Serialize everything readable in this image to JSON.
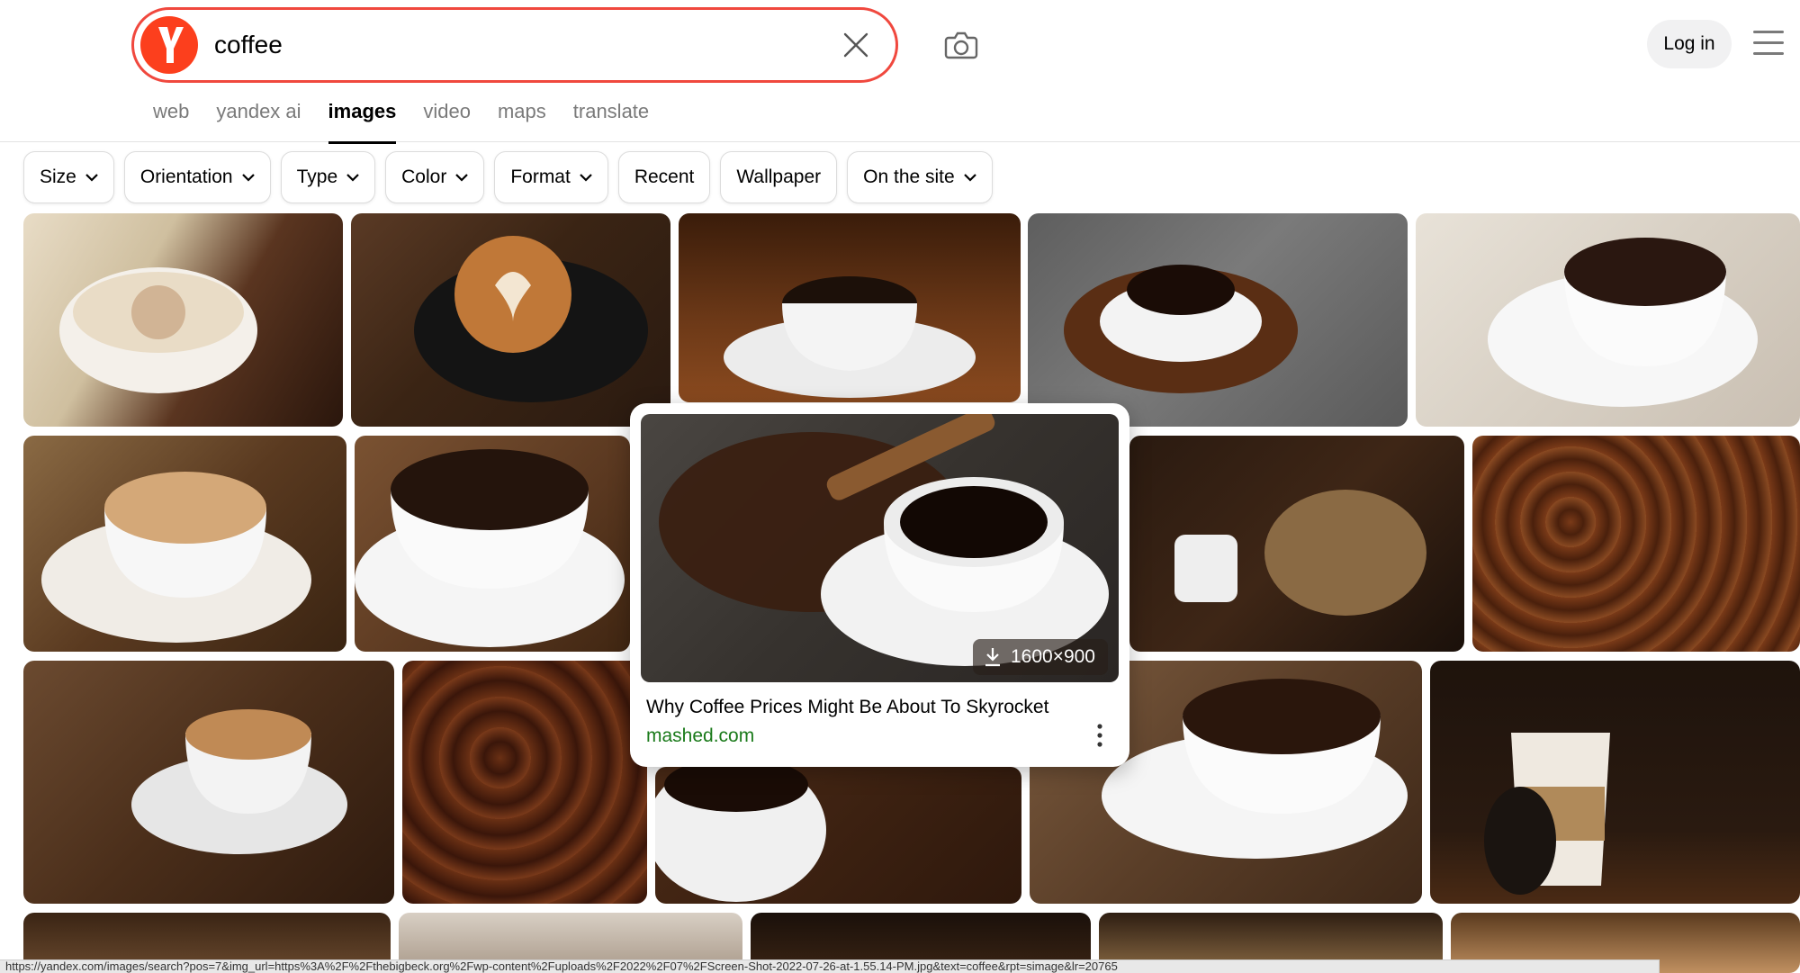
{
  "search": {
    "query": "coffee"
  },
  "header": {
    "login_label": "Log in"
  },
  "tabs": [
    {
      "label": "web",
      "active": false
    },
    {
      "label": "yandex ai",
      "active": false
    },
    {
      "label": "images",
      "active": true
    },
    {
      "label": "video",
      "active": false
    },
    {
      "label": "maps",
      "active": false
    },
    {
      "label": "translate",
      "active": false
    }
  ],
  "filters": [
    {
      "label": "Size",
      "dropdown": true
    },
    {
      "label": "Orientation",
      "dropdown": true
    },
    {
      "label": "Type",
      "dropdown": true
    },
    {
      "label": "Color",
      "dropdown": true
    },
    {
      "label": "Format",
      "dropdown": true
    },
    {
      "label": "Recent",
      "dropdown": false
    },
    {
      "label": "Wallpaper",
      "dropdown": false
    },
    {
      "label": "On the site",
      "dropdown": true
    }
  ],
  "preview": {
    "size_label": "1600×900",
    "title": "Why Coffee Prices Might Be About To Skyrocket",
    "source": "mashed.com"
  },
  "status_url": "https://yandex.com/images/search?pos=7&img_url=https%3A%2F%2Fthebigbeck.org%2Fwp-content%2Fuploads%2F2022%2F07%2FScreen-Shot-2022-07-26-at-1.55.14-PM.jpg&text=coffee&rpt=simage&lr=20765",
  "colors": {
    "accent": "#fc3f1d",
    "source_green": "#1a7a1a"
  }
}
